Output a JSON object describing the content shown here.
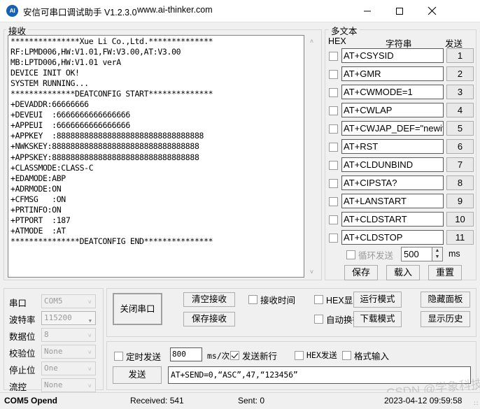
{
  "window": {
    "icon_text": "AI",
    "title": "安信可串口调试助手 V1.2.3.0",
    "url": "www.ai-thinker.com",
    "minimize": "─",
    "maximize": "□",
    "close": "✕"
  },
  "receive": {
    "group_label": "接收",
    "scroll_up": "˄",
    "scroll_down": "˅",
    "text": "***************Xue Li Co.,Ltd.**************\nRF:LPMD006,HW:V1.01,FW:V3.00,AT:V3.00\nMB:LPTD006,HW:V1.01 verA\nDEVICE INIT OK!\nSYSTEM RUNNING...\n**************DEATCONFIG START**************\n+DEVADDR:66666666\n+DEVEUI  :6666666666666666\n+APPEUI  :6666666666666666\n+APPKEY  :88888888888888888888888888888888\n+NWKSKEY:88888888888888888888888888888888\n+APPSKEY:88888888888888888888888888888888\n+CLASSMODE:CLASS-C\n+EDAMODE:ABP\n+ADRMODE:ON\n+CFMSG   :ON\n+PRTINFO:ON\n+PTPORT  :187\n+ATMODE  :AT\n***************DEATCONFIG END***************"
  },
  "multitext": {
    "group_label": "多文本",
    "col_hex": "HEX",
    "col_string": "字符串",
    "col_send": "发送",
    "rows": [
      {
        "command": "AT+CSYSID",
        "send": "1",
        "hex_checked": false
      },
      {
        "command": "AT+GMR",
        "send": "2",
        "hex_checked": false
      },
      {
        "command": "AT+CWMODE=1",
        "send": "3",
        "hex_checked": false
      },
      {
        "command": "AT+CWLAP",
        "send": "4",
        "hex_checked": false
      },
      {
        "command": "AT+CWJAP_DEF=\"newifi_",
        "send": "5",
        "hex_checked": false
      },
      {
        "command": "AT+RST",
        "send": "6",
        "hex_checked": false
      },
      {
        "command": "AT+CLDUNBIND",
        "send": "7",
        "hex_checked": false
      },
      {
        "command": "AT+CIPSTA?",
        "send": "8",
        "hex_checked": false
      },
      {
        "command": "AT+LANSTART",
        "send": "9",
        "hex_checked": false
      },
      {
        "command": "AT+CLDSTART",
        "send": "10",
        "hex_checked": false
      },
      {
        "command": "AT+CLDSTOP",
        "send": "11",
        "hex_checked": false
      }
    ],
    "loop_send_label": "循环发送",
    "loop_interval": "500",
    "loop_unit": "ms",
    "spin_up": "▲",
    "spin_down": "▼",
    "save_label": "保存",
    "load_label": "载入",
    "reset_label": "重置"
  },
  "serial": {
    "fields": [
      {
        "label": "串口",
        "value": "COM5",
        "active": false
      },
      {
        "label": "波特率",
        "value": "115200",
        "active": true
      },
      {
        "label": "数据位",
        "value": "8",
        "active": false
      },
      {
        "label": "校验位",
        "value": "None",
        "active": false
      },
      {
        "label": "停止位",
        "value": "One",
        "active": false
      },
      {
        "label": "流控",
        "value": "None",
        "active": false
      }
    ],
    "chevron": "˅",
    "chevron_active": "▼"
  },
  "controls": {
    "close_port": "关闭串口",
    "clear_receive": "清空接收",
    "save_receive": "保存接收",
    "receive_time_label": "接收时间",
    "receive_time_checked": false,
    "hex_display_label": "HEX显示",
    "hex_display_checked": false,
    "auto_wrap_label": "自动换行",
    "auto_wrap_checked": false,
    "run_mode": "运行模式",
    "download_mode": "下载模式",
    "hide_panel": "隐藏面板",
    "show_history": "显示历史"
  },
  "send": {
    "timed_send_label": "定时发送",
    "timed_send_checked": false,
    "timed_interval": "800",
    "timed_unit": "ms/次",
    "newline_label": "发送新行",
    "newline_checked": true,
    "hex_send_label": "HEX发送",
    "hex_send_checked": false,
    "format_input_label": "格式输入",
    "format_input_checked": false,
    "send_button": "发送",
    "send_value": "AT+SEND=0,“ASC”,47,“123456”"
  },
  "status": {
    "port": "COM5 Opend",
    "received": "Received: 541",
    "sent": "Sent: 0",
    "datetime": "2023-04-12 09:59:58",
    "grip": "∷"
  },
  "watermark": "CSDN @学象科技"
}
